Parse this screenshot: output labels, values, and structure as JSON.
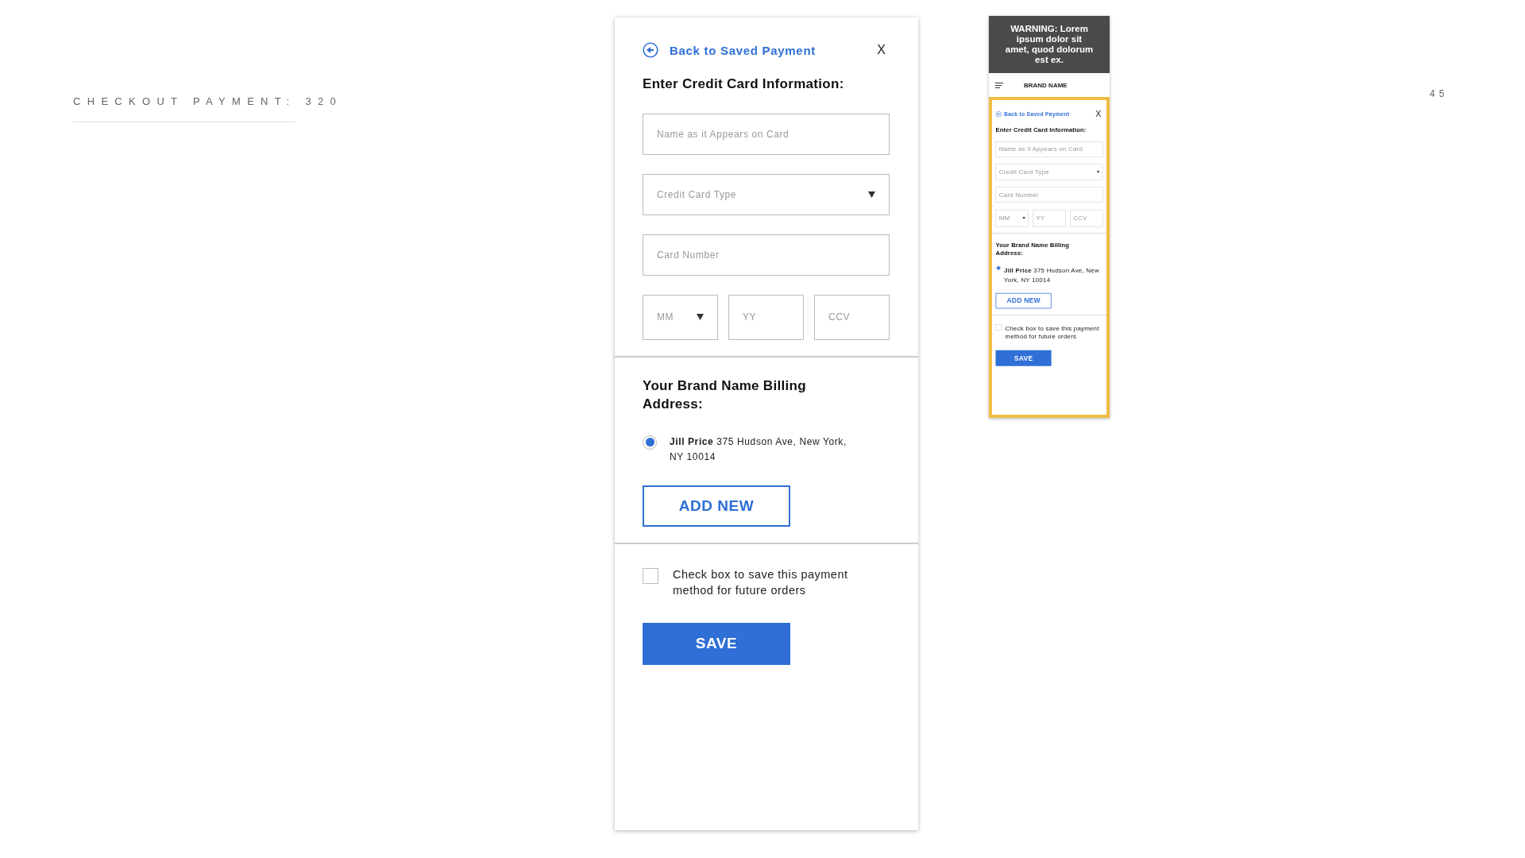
{
  "slide_title": "CHECKOUT PAYMENT: 320",
  "page_number": "45",
  "main_form": {
    "back_link": "Back to Saved Payment",
    "close": "X",
    "heading": "Enter Credit Card Information:",
    "fields": [
      {
        "kind": "text",
        "placeholder": "Name as it Appears on Card"
      },
      {
        "kind": "select",
        "placeholder": "Credit Card Type"
      },
      {
        "kind": "text",
        "placeholder": "Card Number"
      }
    ],
    "expiry_fields": [
      {
        "kind": "select",
        "placeholder": "MM"
      },
      {
        "kind": "text",
        "placeholder": "YY"
      },
      {
        "kind": "text",
        "placeholder": "CCV"
      }
    ],
    "billing_heading": "Your Brand Name Billing Address:",
    "addresses": [
      {
        "text": "**Jill Price** 375 Hudson Ave, New York, NY 10014",
        "selected": true
      }
    ],
    "add_new": "ADD NEW",
    "save_option": {
      "label": "Check box to save this payment method for future orders",
      "checked": false
    },
    "save": "SAVE"
  },
  "preview": {
    "warning": "WARNING: Lorem ipsum dolor sit amet, quod dolorum est ex.",
    "brand_name": "BRAND NAME",
    "form": {
      "back_link": "Back to Saved Payment",
      "close": "X",
      "heading": "Enter Credit Card Information:",
      "fields": [
        {
          "kind": "text",
          "placeholder": "Name as it Appears on Card"
        },
        {
          "kind": "select",
          "placeholder": "Credit Card Type"
        },
        {
          "kind": "text",
          "placeholder": "Card Number"
        }
      ],
      "expiry_fields": [
        {
          "kind": "select",
          "placeholder": "MM"
        },
        {
          "kind": "text",
          "placeholder": "YY"
        },
        {
          "kind": "text",
          "placeholder": "CCV"
        }
      ],
      "billing_heading": "Your Brand Name Billing Address:",
      "addresses": [
        {
          "text": "**Jill Price** 375 Hudson Ave, New York, NY 10014",
          "selected": true
        }
      ],
      "add_new": "ADD NEW",
      "save_option": {
        "label": "Check box to save this payment method for future orders",
        "checked": false
      },
      "save": "SAVE"
    }
  }
}
